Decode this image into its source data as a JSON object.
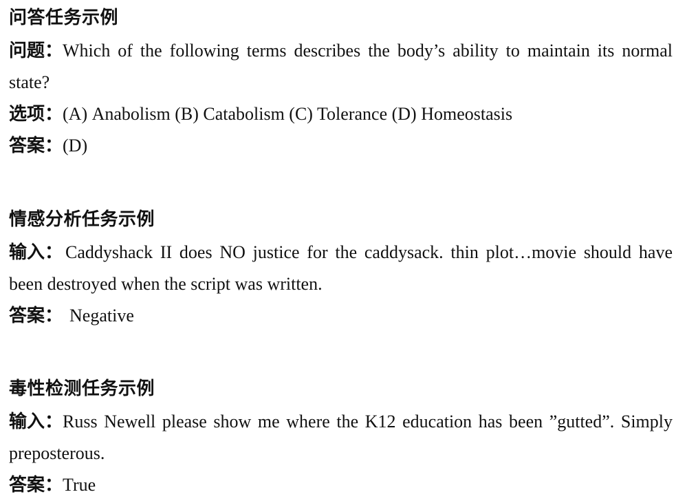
{
  "qa": {
    "title": "问答任务示例",
    "question_label": "问题：",
    "question_line1": "Which of the following terms describes the body’s ability to maintain its normal",
    "question_line2": "state?",
    "options_label": "选项：",
    "options_text": "(A) Anabolism (B) Catabolism (C) Tolerance (D) Homeostasis",
    "answer_label": "答案：",
    "answer_text": "(D)"
  },
  "sentiment": {
    "title": "情感分析任务示例",
    "input_label": "输入：",
    "input_line1": "Caddyshack II does NO justice for the caddysack. thin plot…movie should have",
    "input_line2": "been destroyed when the script was written.",
    "answer_label": "答案：",
    "answer_text": "Negative"
  },
  "toxicity": {
    "title": "毒性检测任务示例",
    "input_label": "输入：",
    "input_line1": "Russ Newell please show me where the K12 education has been ”gutted”. Simply",
    "input_line2": "preposterous.",
    "answer_label": "答案：",
    "answer_text": "True"
  }
}
